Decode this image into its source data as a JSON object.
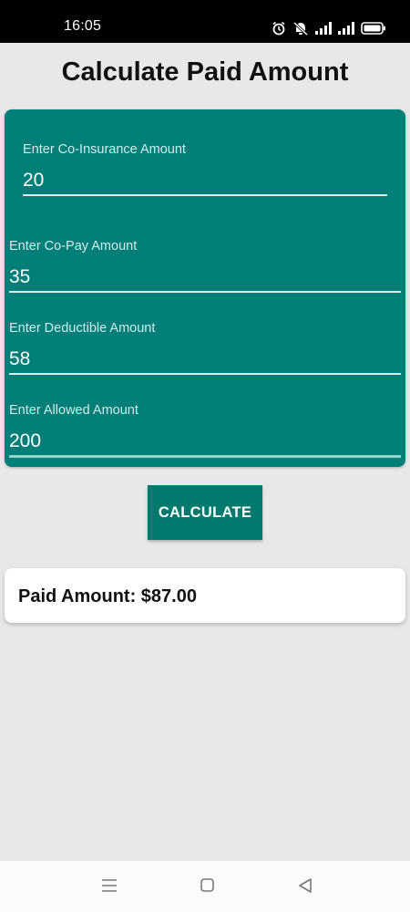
{
  "status_bar": {
    "time": "16:05",
    "icons": [
      "alarm-icon",
      "mute-icon",
      "signal-icon",
      "signal-icon",
      "battery-icon"
    ]
  },
  "page": {
    "title": "Calculate Paid Amount"
  },
  "form": {
    "coinsurance": {
      "label": "Enter Co-Insurance Amount",
      "value": "20"
    },
    "copay": {
      "label": "Enter Co-Pay Amount",
      "value": "35"
    },
    "deductible": {
      "label": "Enter Deductible Amount",
      "value": "58"
    },
    "allowed": {
      "label": "Enter Allowed Amount",
      "value": "200"
    }
  },
  "actions": {
    "calculate_label": "CALCULATE"
  },
  "result": {
    "text": "Paid Amount: $87.00"
  },
  "nav": {
    "buttons": [
      "menu-icon",
      "home-icon",
      "back-icon"
    ]
  },
  "colors": {
    "accent": "#007f78",
    "button": "#007a6d",
    "background": "#e9e7e9"
  }
}
